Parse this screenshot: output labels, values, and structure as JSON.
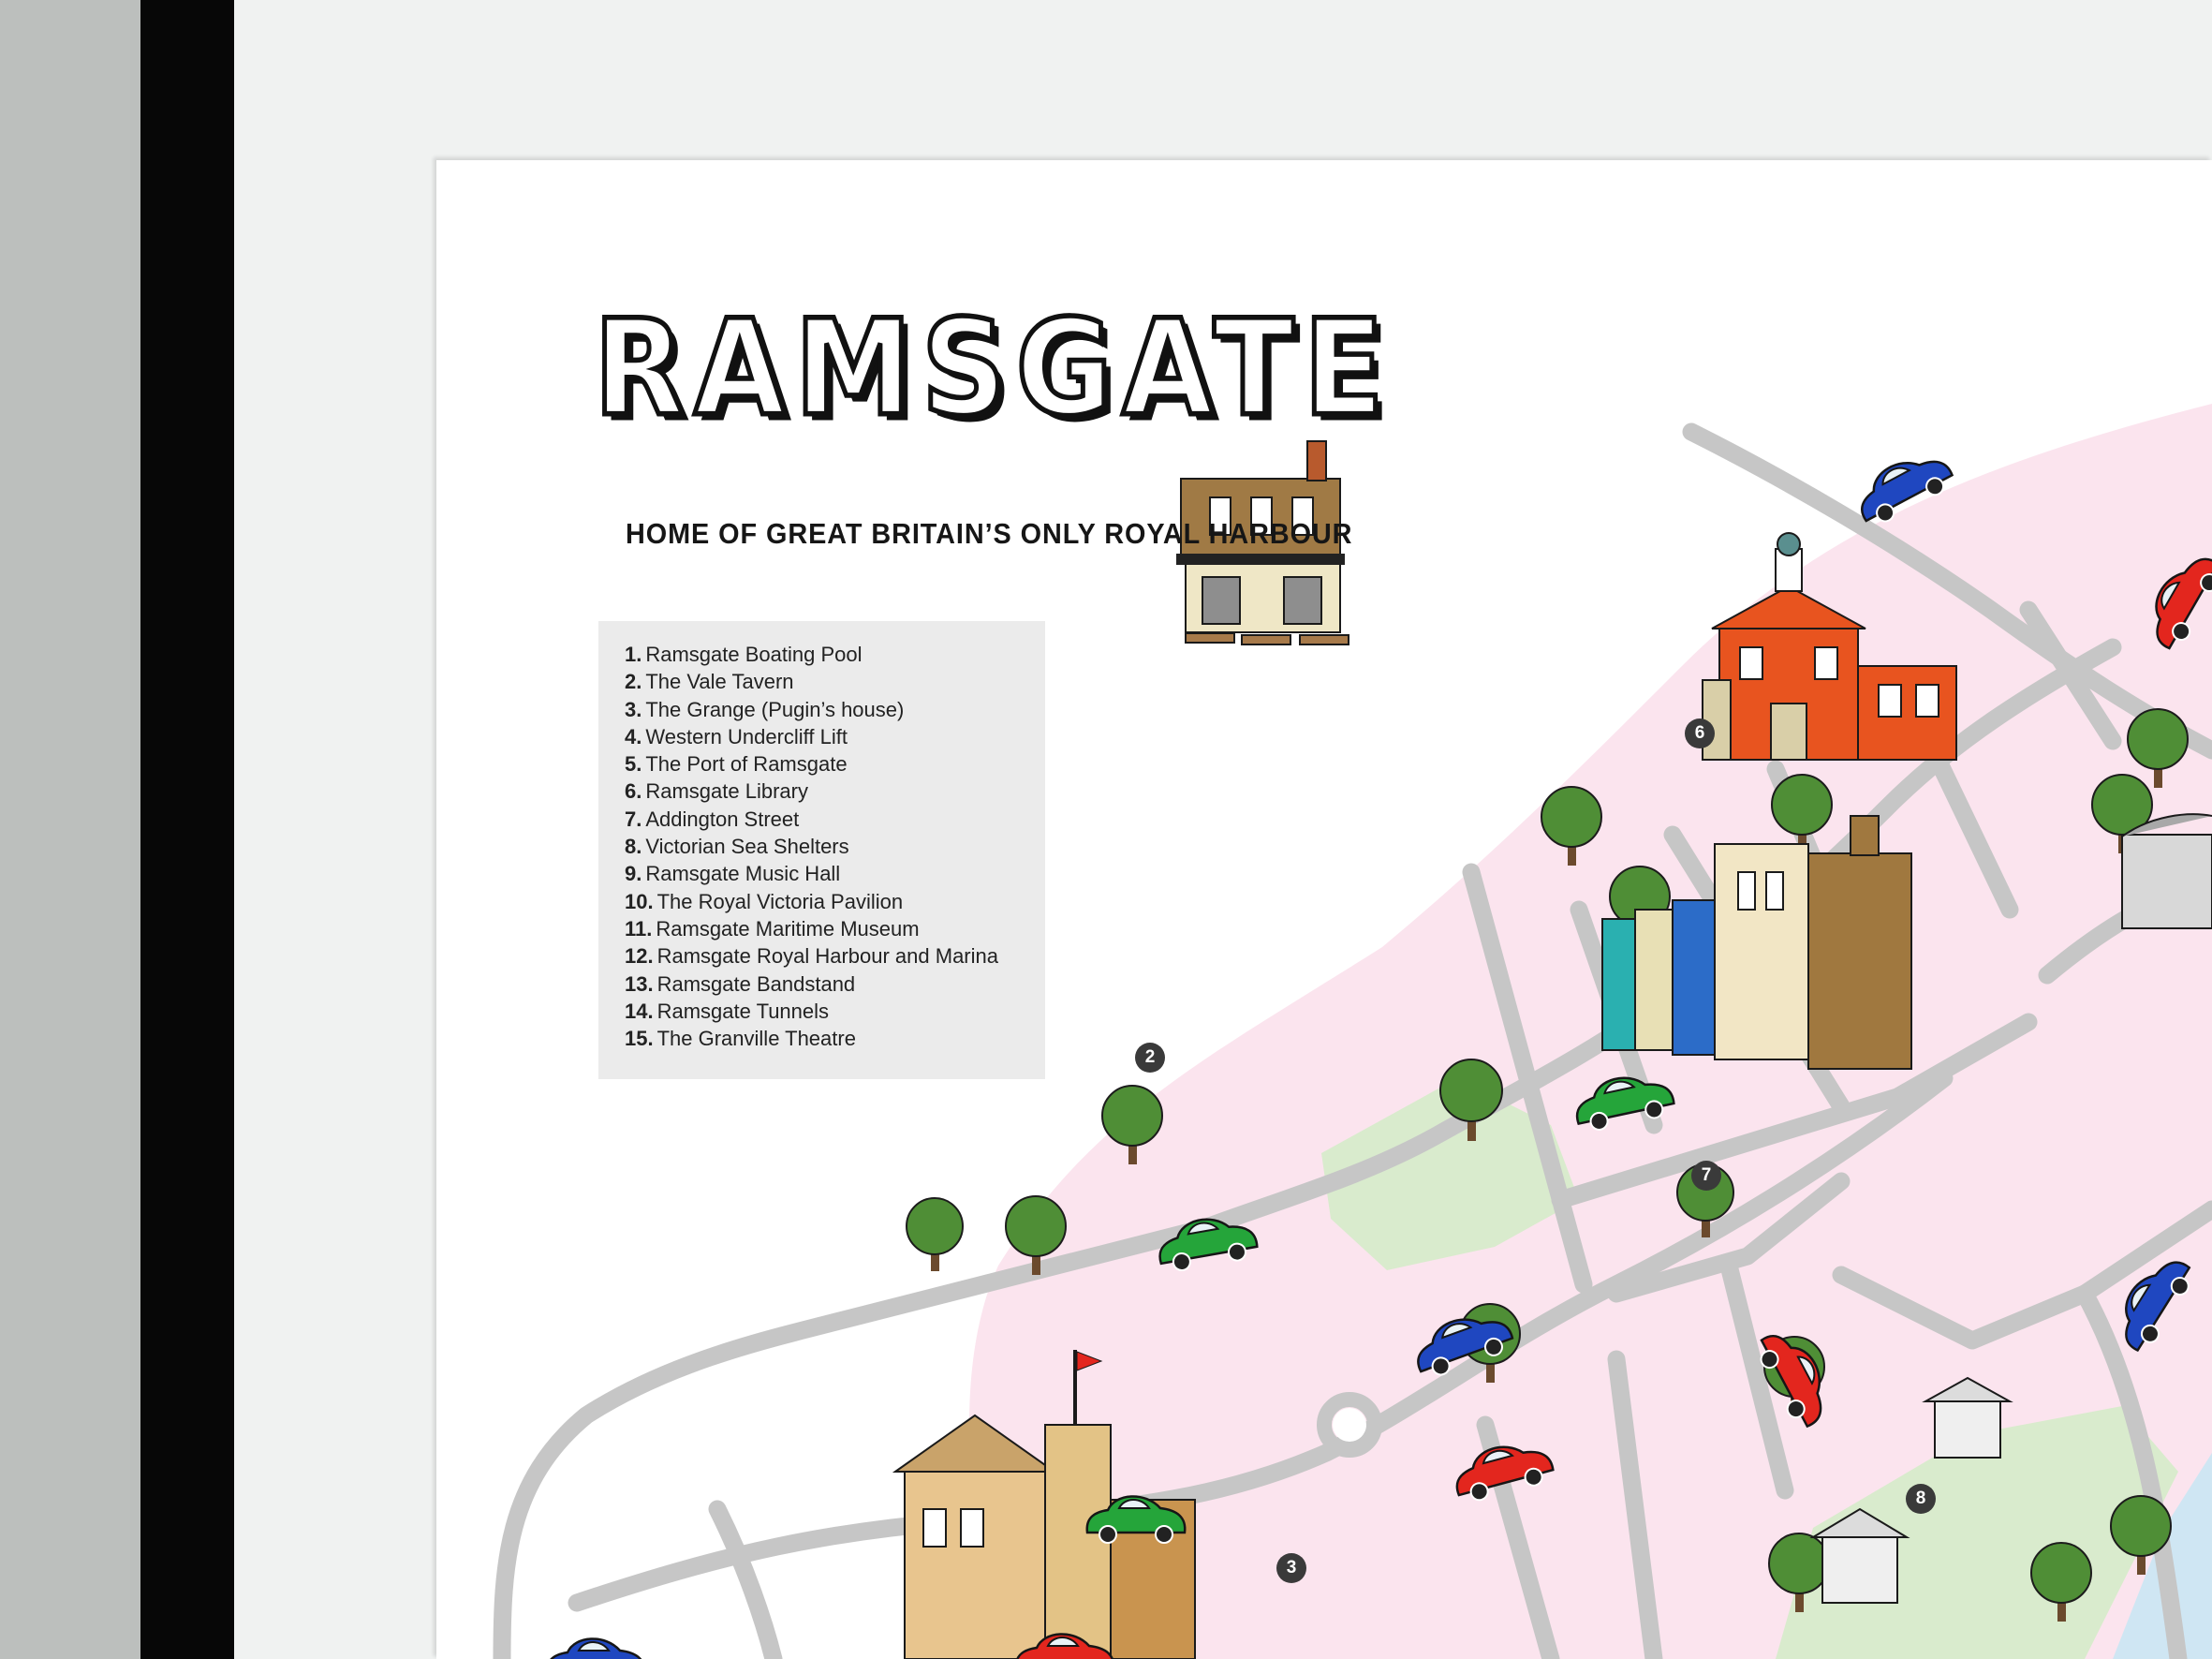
{
  "poster": {
    "title": "RAMSGATE",
    "subtitle": "HOME OF GREAT BRITAIN’S ONLY ROYAL HARBOUR"
  },
  "legend": {
    "items": [
      {
        "num": "1.",
        "label": "Ramsgate Boating Pool"
      },
      {
        "num": "2.",
        "label": "The Vale Tavern"
      },
      {
        "num": "3.",
        "label": "The Grange (Pugin’s house)"
      },
      {
        "num": "4.",
        "label": "Western Undercliff Lift"
      },
      {
        "num": "5.",
        "label": "The Port of Ramsgate"
      },
      {
        "num": "6.",
        "label": "Ramsgate Library"
      },
      {
        "num": "7.",
        "label": "Addington Street"
      },
      {
        "num": "8.",
        "label": "Victorian Sea Shelters"
      },
      {
        "num": "9.",
        "label": "Ramsgate Music Hall"
      },
      {
        "num": "10.",
        "label": "The Royal Victoria Pavilion"
      },
      {
        "num": "11.",
        "label": "Ramsgate Maritime Museum"
      },
      {
        "num": "12.",
        "label": "Ramsgate Royal Harbour and Marina"
      },
      {
        "num": "13.",
        "label": "Ramsgate Bandstand"
      },
      {
        "num": "14.",
        "label": "Ramsgate Tunnels"
      },
      {
        "num": "15.",
        "label": "The Granville Theatre"
      }
    ]
  },
  "map": {
    "markers": [
      "6",
      "2",
      "7",
      "3",
      "8"
    ],
    "colors": {
      "town_area": "#fbe4ee",
      "park": "#d9ebcd",
      "sea": "#cfe6f3",
      "road": "#c6c6c6",
      "car_blue": "#1f47c0",
      "car_red": "#e3261e",
      "car_green": "#25a53a",
      "library_brick": "#e8541f"
    },
    "icons": [
      "car-icon",
      "tree-icon",
      "building-icon",
      "bench-icon",
      "flag-icon"
    ]
  }
}
